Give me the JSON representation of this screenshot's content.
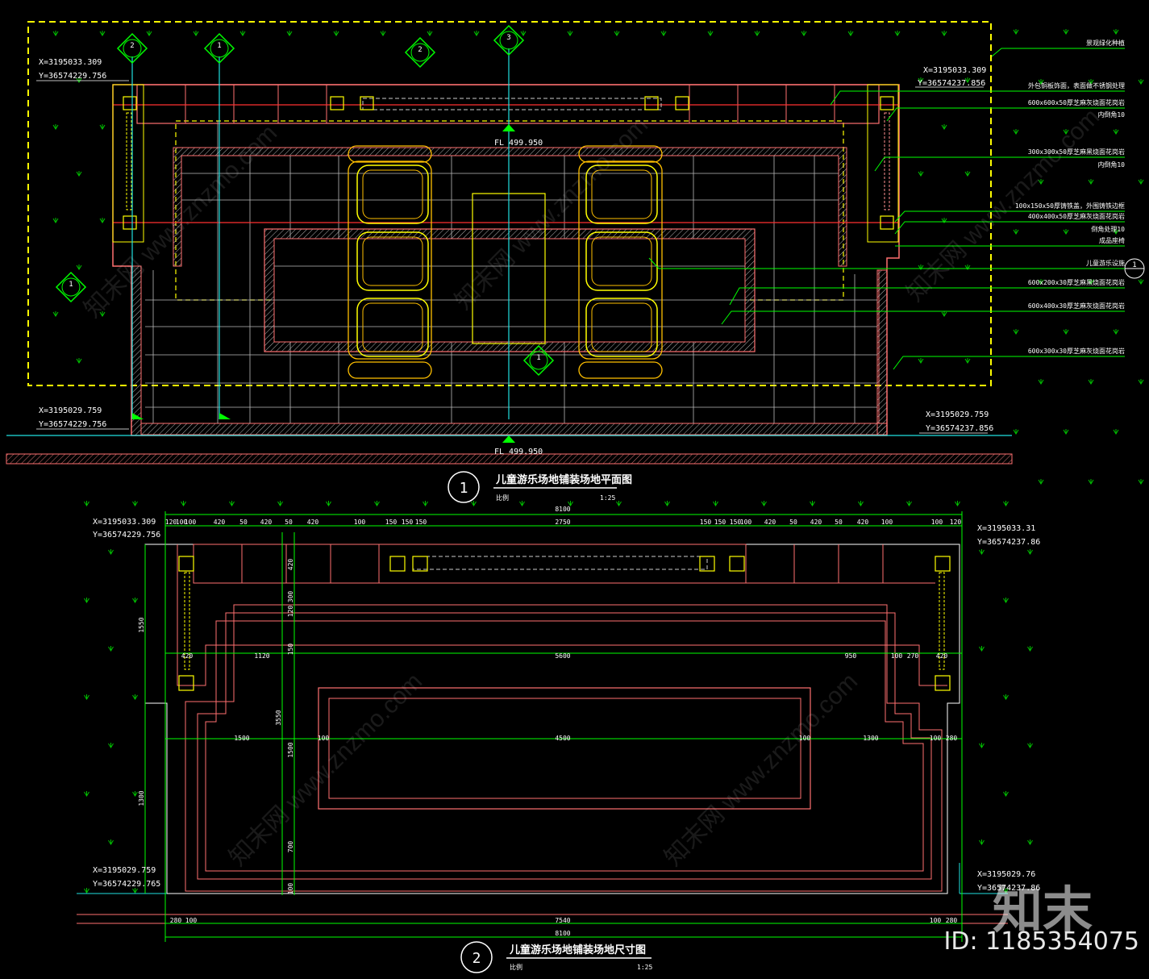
{
  "plan1": {
    "coords": {
      "top_left": [
        "X=3195033.309",
        "Y=36574229.756"
      ],
      "top_right": [
        "X=3195033.309",
        "Y=36574237.856"
      ],
      "bottom_left": [
        "X=3195029.759",
        "Y=36574229.756"
      ],
      "bottom_right": [
        "X=3195029.759",
        "Y=36574237.856"
      ]
    },
    "elevations": {
      "top": "FL 499.950",
      "bottom": "FL 499.950"
    },
    "section_markers": [
      "2",
      "1",
      "2",
      "3",
      "1",
      "1"
    ],
    "title_number": "1",
    "title": "儿童游乐场地铺装场地平面图",
    "scale_label": "比例",
    "scale": "1:25",
    "callouts": [
      "景观绿化种植",
      "外包铜板饰面，表面做不锈钢处理",
      "600x600x50厚芝麻灰烧面花岗岩",
      "内倒角10",
      "300x300x50厚芝麻黑烧面花岗岩",
      "内倒角10",
      "100x150x50厚铸铁盖，外围铸铁边框",
      "400x400x50厚芝麻灰烧面花岗岩",
      "倒角处理10",
      "成品座椅",
      "儿童游乐设施",
      "600x200x30厚芝麻黑烧面花岗岩",
      "600x400x30厚芝麻灰烧面花岗岩",
      "600x300x30厚芝麻灰烧面花岗岩"
    ]
  },
  "plan2": {
    "coords": {
      "top_left": [
        "X=3195033.309",
        "Y=36574229.756"
      ],
      "top_right": [
        "X=3195033.31",
        "Y=36574237.86"
      ],
      "bottom_left": [
        "X=3195029.759",
        "Y=36574229.765"
      ],
      "bottom_right": [
        "X=3195029.76",
        "Y=36574237.86"
      ]
    },
    "title_number": "2",
    "title": "儿童游乐场地铺装场地尺寸图",
    "scale_label": "比例",
    "scale": "1:25",
    "dims_top_left": [
      "120",
      "100",
      "100",
      "420",
      "50",
      "420",
      "50",
      "420",
      "100",
      "150",
      "150",
      "150"
    ],
    "dims_top_center": "2750",
    "dims_top_right": [
      "150",
      "150",
      "150",
      "100",
      "420",
      "50",
      "420",
      "50",
      "420",
      "100",
      "100",
      "120"
    ],
    "dims_total_top": "8100",
    "dims_row_2": {
      "left": "420",
      "mid_left": "1120",
      "center": "5600",
      "mid_right": "950",
      "right_a": "100",
      "right_b": "270",
      "right_c": "420"
    },
    "dims_row_3": {
      "left": "1500",
      "a": "100",
      "center": "4500",
      "b": "100",
      "right": "1300",
      "c": "100",
      "d": "280"
    },
    "dims_bottom": {
      "left_a": "280",
      "left_b": "100",
      "center": "7540",
      "right_a": "100",
      "right_b": "280",
      "total": "8100"
    },
    "dims_vertical": [
      "420",
      "300",
      "120",
      "150",
      "3550",
      "1500",
      "700",
      "100",
      "1550",
      "1300"
    ]
  },
  "brand": "知末",
  "id_label": "ID: 1185354075",
  "watermark": "知末网 www.znzmo.com",
  "colors": {
    "background": "#000000",
    "dim_green": "#00ff00",
    "frame_yellow": "#ffff00",
    "paving_red": "#ff6060",
    "axis_cyan": "#20e0e0",
    "seat_orange": "#ffc000",
    "grid_gray": "#bbbbbb"
  }
}
